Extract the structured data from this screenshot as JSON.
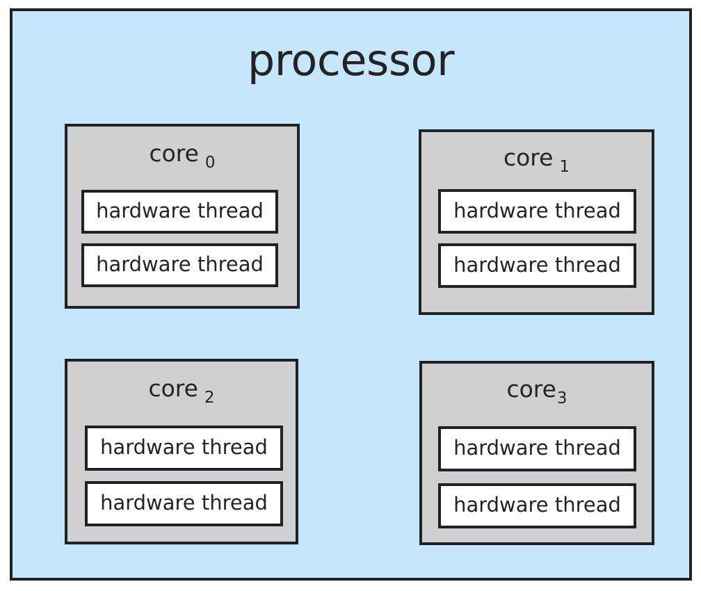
{
  "diagram": {
    "title": "processor",
    "background_color": "#c6e7fb",
    "border_color": "#202124",
    "core_fill_color": "#d0d0d0",
    "thread_fill_color": "#ffffff",
    "cores": [
      {
        "label": "core",
        "index": "0",
        "threads": [
          {
            "label": "hardware thread"
          },
          {
            "label": "hardware thread"
          }
        ]
      },
      {
        "label": "core",
        "index": "1",
        "threads": [
          {
            "label": "hardware thread"
          },
          {
            "label": "hardware thread"
          }
        ]
      },
      {
        "label": "core",
        "index": "2",
        "threads": [
          {
            "label": "hardware thread"
          },
          {
            "label": "hardware thread"
          }
        ]
      },
      {
        "label": "core",
        "index": "3",
        "threads": [
          {
            "label": "hardware thread"
          },
          {
            "label": "hardware thread"
          }
        ]
      }
    ]
  }
}
